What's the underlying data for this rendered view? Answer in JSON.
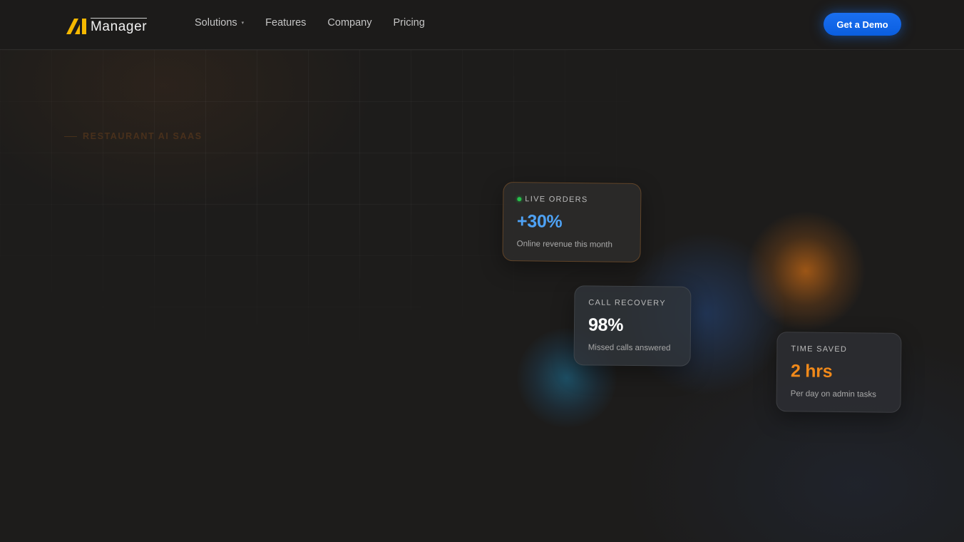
{
  "header": {
    "logo": {
      "mark": "AI",
      "word": "Manager"
    },
    "nav": [
      {
        "label": "Solutions",
        "has_dropdown": true,
        "caret": "▾"
      },
      {
        "label": "Features"
      },
      {
        "label": "Company"
      },
      {
        "label": "Pricing"
      }
    ],
    "cta_label": "Get a Demo"
  },
  "hero": {
    "eyebrow": "RESTAURANT AI SAAS"
  },
  "cards": {
    "live_orders": {
      "label": "LIVE ORDERS",
      "value": "+30%",
      "description": "Online revenue this month",
      "status_icon": "live-dot"
    },
    "call_recovery": {
      "label": "CALL RECOVERY",
      "value": "98%",
      "description": "Missed calls answered"
    },
    "time_saved": {
      "label": "TIME SAVED",
      "value": "2 hrs",
      "description": "Per day on admin tasks"
    }
  },
  "colors": {
    "background": "#1d1c1b",
    "accent_blue": "#1a6ff0",
    "value_blue": "#4ea2f5",
    "value_orange": "#f0891a",
    "logo_yellow": "#f5b800",
    "live_green": "#26c14a"
  }
}
